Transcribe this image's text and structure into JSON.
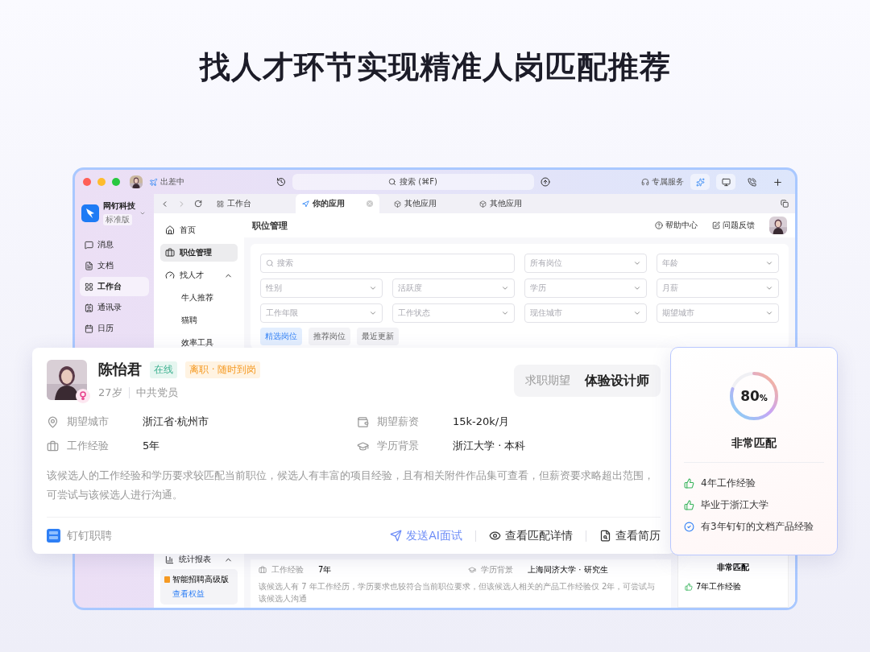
{
  "headline": "找人才环节实现精准人岗匹配推荐",
  "titlebar": {
    "status": "出差中",
    "search": "搜索 (⌘F)",
    "service": "专属服务"
  },
  "org": {
    "name": "网钉科技",
    "plan": "标准版"
  },
  "rail": [
    {
      "label": "消息",
      "kind": "message",
      "selected": false
    },
    {
      "label": "文档",
      "kind": "doc",
      "selected": false
    },
    {
      "label": "工作台",
      "kind": "grid",
      "selected": true
    },
    {
      "label": "通讯录",
      "kind": "contact",
      "selected": false
    },
    {
      "label": "日历",
      "kind": "calendar",
      "selected": false
    }
  ],
  "browser_tabs": [
    {
      "label": "工作台",
      "kind": "grid",
      "selected": false
    },
    {
      "label": "你的应用",
      "kind": "app",
      "selected": true
    },
    {
      "label": "其他应用",
      "kind": "box",
      "selected": false
    },
    {
      "label": "其他应用",
      "kind": "box",
      "selected": false
    }
  ],
  "nav": [
    {
      "label": "首页",
      "kind": "home",
      "selected": false
    },
    {
      "label": "职位管理",
      "kind": "briefcase",
      "selected": true
    },
    {
      "label": "找人才",
      "kind": "gauge",
      "selected": false,
      "expanded": true,
      "children": [
        {
          "label": "牛人推荐"
        },
        {
          "label": "猫聘"
        },
        {
          "label": "效率工具"
        }
      ]
    }
  ],
  "nav_bottom": {
    "label": "统计报表",
    "expanded": true
  },
  "upgrade": {
    "title": "智能招聘高级版",
    "link": "查看权益"
  },
  "page": {
    "title": "职位管理",
    "actions": [
      {
        "label": "帮助中心",
        "kind": "help"
      },
      {
        "label": "问题反馈",
        "kind": "edit"
      }
    ]
  },
  "filters": [
    {
      "placeholder": "搜索",
      "kind": "search"
    },
    {
      "placeholder": "所有岗位",
      "kind": "select"
    },
    {
      "placeholder": "年龄",
      "kind": "select"
    },
    {
      "placeholder": "性别",
      "kind": "select"
    },
    {
      "placeholder": "活跃度",
      "kind": "select"
    },
    {
      "placeholder": "学历",
      "kind": "select"
    },
    {
      "placeholder": "月薪",
      "kind": "select"
    },
    {
      "placeholder": "工作年限",
      "kind": "select"
    },
    {
      "placeholder": "工作状态",
      "kind": "select"
    },
    {
      "placeholder": "现住城市",
      "kind": "select"
    },
    {
      "placeholder": "期望城市",
      "kind": "select"
    }
  ],
  "filter_tabs": [
    {
      "label": "精选岗位",
      "selected": true
    },
    {
      "label": "推荐岗位",
      "selected": false
    },
    {
      "label": "最近更新",
      "selected": false
    }
  ],
  "list_candidate": {
    "fields": [
      {
        "label": "工作经验",
        "value": "7年",
        "kind": "work"
      },
      {
        "label": "学历背景",
        "value": "上海同济大学 · 研究生",
        "kind": "edu"
      }
    ],
    "summary": "该候选人有 7 年工作经历，学历要求也较符合当前职位要求，但该候选人相关的产品工作经验仅 2年，可尝试与该候选人沟通"
  },
  "list_match": {
    "verdict": "非常匹配",
    "points": [
      {
        "text": "7年工作经验",
        "kind": "thumb"
      }
    ]
  },
  "candidate": {
    "name": "陈怡君",
    "tags": [
      {
        "label": "在线",
        "kind": "online"
      },
      {
        "label": "离职 · 随时到岗",
        "kind": "availability"
      }
    ],
    "age": "27岁",
    "politics": "中共党员",
    "expectation_label": "求职期望",
    "expectation": "体验设计师",
    "fields": [
      {
        "label": "期望城市",
        "value": "浙江省·杭州市",
        "kind": "pin"
      },
      {
        "label": "期望薪资",
        "value": "15k-20k/月",
        "kind": "wallet"
      },
      {
        "label": "工作经验",
        "value": "5年",
        "kind": "work"
      },
      {
        "label": "学历背景",
        "value": "浙江大学 · 本科",
        "kind": "edu"
      }
    ],
    "summary": "该候选人的工作经验和学历要求较匹配当前职位，候选人有丰富的项目经验，且有相关附件作品集可查看，但薪资要求略超出范围，可尝试与该候选人进行沟通。",
    "source": "钉钉职聘",
    "actions": [
      {
        "label": "发送AI面试",
        "kind": "send"
      },
      {
        "label": "查看匹配详情",
        "kind": "eye"
      },
      {
        "label": "查看简历",
        "kind": "resume"
      }
    ]
  },
  "match": {
    "score": "80",
    "unit": "%",
    "level": 0.8,
    "verdict": "非常匹配",
    "points": [
      {
        "text": "4年工作经验",
        "kind": "thumb"
      },
      {
        "text": "毕业于浙江大学",
        "kind": "thumb"
      },
      {
        "text": "有3年钉钉的文档产品经验",
        "kind": "check"
      }
    ]
  }
}
